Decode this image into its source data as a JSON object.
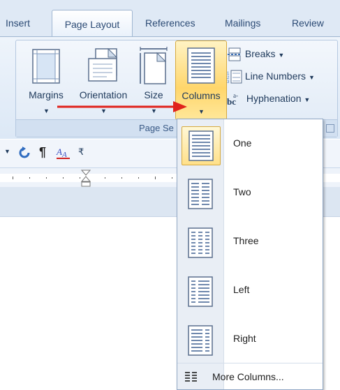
{
  "tabs": {
    "insert": "Insert",
    "page_layout": "Page Layout",
    "references": "References",
    "mailings": "Mailings",
    "review": "Review"
  },
  "ribbon": {
    "group_label": "Page Se",
    "buttons": {
      "margins": "Margins",
      "orientation": "Orientation",
      "size": "Size",
      "columns": "Columns"
    },
    "small_buttons": {
      "breaks": "Breaks",
      "line_numbers": "Line Numbers",
      "hyphenation": "Hyphenation"
    }
  },
  "columns_menu": {
    "items": [
      {
        "label": "One"
      },
      {
        "label": "Two"
      },
      {
        "label": "Three"
      },
      {
        "label": "Left"
      },
      {
        "label": "Right"
      }
    ],
    "more_columns": "More Columns..."
  },
  "colors": {
    "highlight": "#ffd66b",
    "annotation_arrow": "#e0231c",
    "ribbon_blue": "#dce8f6"
  },
  "icons": [
    "margins-icon",
    "orientation-icon",
    "size-icon",
    "columns-icon",
    "breaks-icon",
    "line-numbers-icon",
    "hyphenation-icon",
    "undo-icon",
    "pilcrow-icon",
    "text-format-icon",
    "customize-icon"
  ]
}
